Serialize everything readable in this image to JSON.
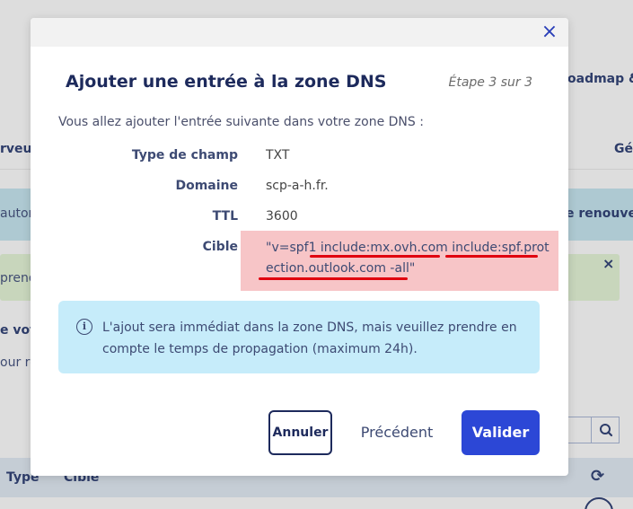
{
  "background": {
    "roadmap": "oadmap &",
    "serveurs": "rveurs",
    "ge": "Gé",
    "auto": "autom",
    "renouvel": "e renouvel",
    "prend": "prend",
    "green_close": "×",
    "votre": "e votr",
    "pour": "our re",
    "table_type": "Type",
    "table_cible": "Cible",
    "refresh_icon": "⟳"
  },
  "modal": {
    "close_label": "×",
    "title": "Ajouter une entrée à la zone DNS",
    "step": "Étape 3 sur 3",
    "intro": "Vous allez ajouter l'entrée suivante dans votre zone DNS :",
    "fields": {
      "type": {
        "label": "Type de champ",
        "value": "TXT"
      },
      "domain": {
        "label": "Domaine",
        "value": "scp-a-h.fr."
      },
      "ttl": {
        "label": "TTL",
        "value": "3600"
      },
      "target": {
        "label": "Cible",
        "line1": "\"v=spf1 include:mx.ovh.com include:spf.prot",
        "line2": "ection.outlook.com -all\""
      }
    },
    "info": {
      "icon": "i",
      "text": "L'ajout sera immédiat dans la zone DNS, mais veuillez prendre en compte le temps de propagation (maximum 24h)."
    },
    "buttons": {
      "cancel": "Annuler",
      "previous": "Précédent",
      "validate": "Valider"
    }
  },
  "colors": {
    "accent": "#2c47d6",
    "highlight": "#f7c5c7",
    "underline": "#e0000e",
    "info_bg": "#c6ecfa"
  }
}
